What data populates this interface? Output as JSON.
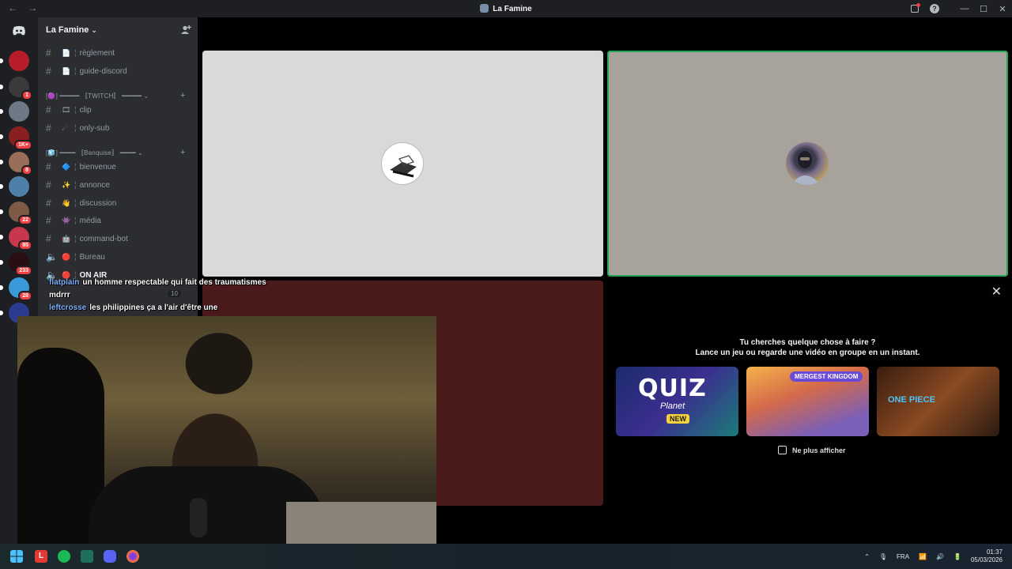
{
  "window": {
    "title": "La Famine",
    "back": "←",
    "forward": "→",
    "minimize": "—",
    "maximize": "☐",
    "close": "✕"
  },
  "servers": [
    {
      "badge": ""
    },
    {
      "badge": "1"
    },
    {
      "badge": ""
    },
    {
      "badge": "1K+"
    },
    {
      "badge": "8"
    },
    {
      "badge": ""
    },
    {
      "badge": "22"
    },
    {
      "badge": "85"
    },
    {
      "badge": "233"
    },
    {
      "badge": "28"
    },
    {
      "badge": ""
    }
  ],
  "guild": {
    "name": "La Famine",
    "chevron": "⌄"
  },
  "channels": {
    "top": [
      {
        "name": "règlement",
        "emoji": "📄"
      },
      {
        "name": "guide-discord",
        "emoji": "📄"
      }
    ],
    "cat_twitch": "[🟣] ━━━━━ 〚TWITCH〛 ━━━━━ ⌄",
    "twitch": [
      {
        "name": "clip",
        "emoji": "🎞"
      },
      {
        "name": "only-sub",
        "emoji": "☄"
      }
    ],
    "cat_banquise": "[🧊] ━━━━ 〚Banquise〛 ━━━━ ⌄",
    "banquise": [
      {
        "name": "bienvenue",
        "emoji": "🔷"
      },
      {
        "name": "annonce",
        "emoji": "✨"
      },
      {
        "name": "discussion",
        "emoji": "👋"
      },
      {
        "name": "média",
        "emoji": "👾"
      },
      {
        "name": "command-bot",
        "emoji": "🤖"
      }
    ],
    "voice": [
      {
        "name": "Bureau",
        "emoji": "🔴"
      },
      {
        "name": "ON AIR",
        "emoji": "🔴"
      }
    ],
    "salle_count": "10"
  },
  "activity": {
    "line1": "Tu cherches quelque chose à faire ?",
    "line2": "Lance un jeu ou regarde une vidéo en groupe en un instant.",
    "cards": [
      {
        "title": "QUIZ",
        "sub": "Planet",
        "tag": "NEW"
      },
      {
        "title": "MERGEST KINGDOM"
      },
      {
        "title": "ONE PIECE"
      }
    ],
    "checkbox_label": "Ne plus afficher"
  },
  "chat": [
    {
      "user": "flatplain",
      "text": "un homme respectable qui fait des traumatismes mdrrr"
    },
    {
      "user": "leftcrosse",
      "text": "les philippines ça a l'air d'être une"
    }
  ],
  "taskbar": {
    "lang": "FRA",
    "time": "01:37",
    "date": "05/03/2026"
  }
}
